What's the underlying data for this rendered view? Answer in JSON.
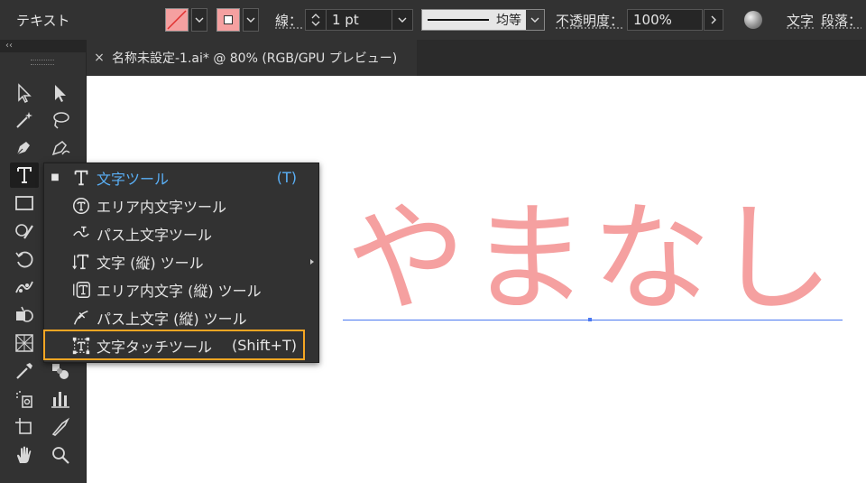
{
  "control_bar": {
    "mode_label": "テキスト",
    "stroke_label": "線：",
    "stroke_weight": "1 pt",
    "stroke_profile": "均等",
    "opacity_label": "不透明度：",
    "opacity_value": "100%",
    "character_label": "文字",
    "paragraph_label": "段落：",
    "fill_color": "#f5a0a0",
    "stroke_color": "#f5a0a0"
  },
  "tab": {
    "close": "×",
    "title": "名称未設定-1.ai* @ 80% (RGB/GPU プレビュー)"
  },
  "toolbar": {
    "collapse": "‹‹"
  },
  "canvas": {
    "art_text": "やまなし",
    "art_color": "#f5a0a0",
    "baseline_color": "#4a78f0"
  },
  "flyout": {
    "items": [
      {
        "label": "文字ツール",
        "shortcut": "(T)",
        "icon": "type-icon",
        "current": true
      },
      {
        "label": "エリア内文字ツール",
        "shortcut": "",
        "icon": "area-type-icon",
        "current": false
      },
      {
        "label": "パス上文字ツール",
        "shortcut": "",
        "icon": "type-on-path-icon",
        "current": false
      },
      {
        "label": "文字 (縦) ツール",
        "shortcut": "",
        "icon": "vertical-type-icon",
        "current": false
      },
      {
        "label": "エリア内文字 (縦) ツール",
        "shortcut": "",
        "icon": "vertical-area-type-icon",
        "current": false
      },
      {
        "label": "パス上文字 (縦) ツール",
        "shortcut": "",
        "icon": "vertical-type-on-path-icon",
        "current": false
      },
      {
        "label": "文字タッチツール",
        "shortcut": "(Shift+T)",
        "icon": "touch-type-icon",
        "current": false
      }
    ],
    "highlight_color": "#f5a623"
  }
}
